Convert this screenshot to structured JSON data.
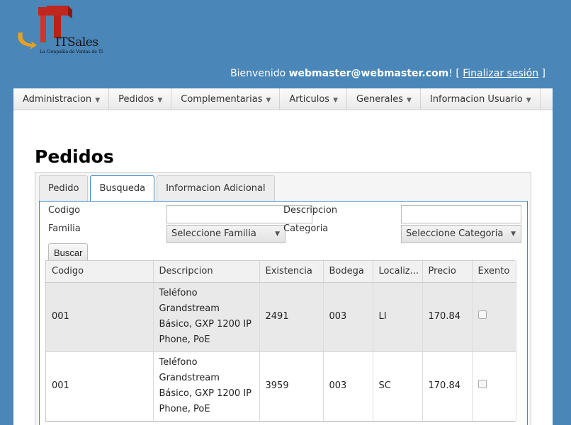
{
  "logo": {
    "text": "ITSales",
    "subtitle": "La Compañía de Ventas de TI"
  },
  "header": {
    "welcome_prefix": "Bienvenido",
    "user": "webmaster@webmaster.com",
    "exclaim": "! [",
    "logout": "Finalizar sesión",
    "close_bracket": "]"
  },
  "menu": {
    "items": [
      {
        "label": "Administracion"
      },
      {
        "label": "Pedidos"
      },
      {
        "label": "Complementarias"
      },
      {
        "label": "Articulos"
      },
      {
        "label": "Generales"
      },
      {
        "label": "Informacion Usuario"
      }
    ]
  },
  "page": {
    "title": "Pedidos"
  },
  "tabs": [
    {
      "label": "Pedido",
      "active": false
    },
    {
      "label": "Busqueda",
      "active": true
    },
    {
      "label": "Informacion Adicional",
      "active": false
    }
  ],
  "search": {
    "codigo_label": "Codigo",
    "codigo_value": "",
    "descripcion_label": "Descripcion",
    "descripcion_value": "",
    "familia_label": "Familia",
    "familia_select": "Seleccione Familia",
    "categoria_label": "Categoria",
    "categoria_select": "Seleccione Categoria",
    "buscar": "Buscar"
  },
  "grid": {
    "headers": [
      "Codigo",
      "Descripcion",
      "Existencia",
      "Bodega",
      "Localiz...",
      "Precio",
      "Exento"
    ],
    "rows": [
      {
        "codigo": "001",
        "descripcion": "Teléfono Grandstream Básico, GXP 1200 IP Phone, PoE",
        "existencia": "2491",
        "bodega": "003",
        "localizacion": "LI",
        "precio": "170.84",
        "exento": false
      },
      {
        "codigo": "001",
        "descripcion": "Teléfono Grandstream Básico, GXP 1200 IP Phone, PoE",
        "existencia": "3959",
        "bodega": "003",
        "localizacion": "SC",
        "precio": "170.84",
        "exento": false
      }
    ]
  },
  "colors": {
    "background": "#4a86b8",
    "accent": "#3b88c8",
    "logo_red": "#c0281f",
    "logo_orange": "#e8a020"
  },
  "icons": {
    "menu_caret": "caret-down-icon",
    "select_arrow": "triangle-down-icon"
  }
}
